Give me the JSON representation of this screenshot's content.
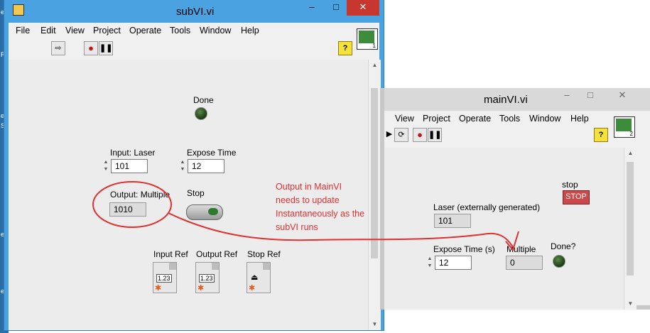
{
  "desktop": {
    "edge_letters": [
      "e",
      "R",
      "e",
      "S",
      "e",
      "e"
    ]
  },
  "sub_window": {
    "title": "subVI.vi",
    "window_buttons": {
      "minimize": "–",
      "maximize": "□",
      "close": "✕"
    },
    "menu": [
      "File",
      "Edit",
      "View",
      "Project",
      "Operate",
      "Tools",
      "Window",
      "Help"
    ],
    "toolbar": {
      "run_icon": "run-arrow-icon",
      "abort_icon": "abort-stop-icon",
      "pause_icon": "pause-icon",
      "help_label": "?"
    },
    "vi_icon_number": "1",
    "panel": {
      "done_label": "Done",
      "input_laser_label": "Input: Laser",
      "input_laser_value": "101",
      "expose_time_label": "Expose Time",
      "expose_time_value": "12",
      "output_multiple_label": "Output: Multiple",
      "output_multiple_value": "1010",
      "stop_label": "Stop",
      "input_ref_label": "Input Ref",
      "output_ref_label": "Output Ref",
      "stop_ref_label": "Stop Ref",
      "refnum_glyph": "1.23"
    }
  },
  "main_window": {
    "title": "mainVI.vi",
    "window_buttons": {
      "minimize": "–",
      "maximize": "□",
      "close": "✕"
    },
    "menu": [
      "View",
      "Project",
      "Operate",
      "Tools",
      "Window",
      "Help"
    ],
    "toolbar": {
      "help_label": "?"
    },
    "vi_icon_number": "2",
    "panel": {
      "stop_label": "stop",
      "stop_button_text": "STOP",
      "laser_label": "Laser (externally generated)",
      "laser_value": "101",
      "expose_time_label": "Expose Time (s)",
      "expose_time_value": "12",
      "multiple_label": "Multiple",
      "multiple_value": "0",
      "done_label": "Done?"
    }
  },
  "annotation": {
    "text": "Output in MainVI\nneeds to update\nInstantaneously as the\nsubVI runs",
    "color": "#e03030"
  }
}
